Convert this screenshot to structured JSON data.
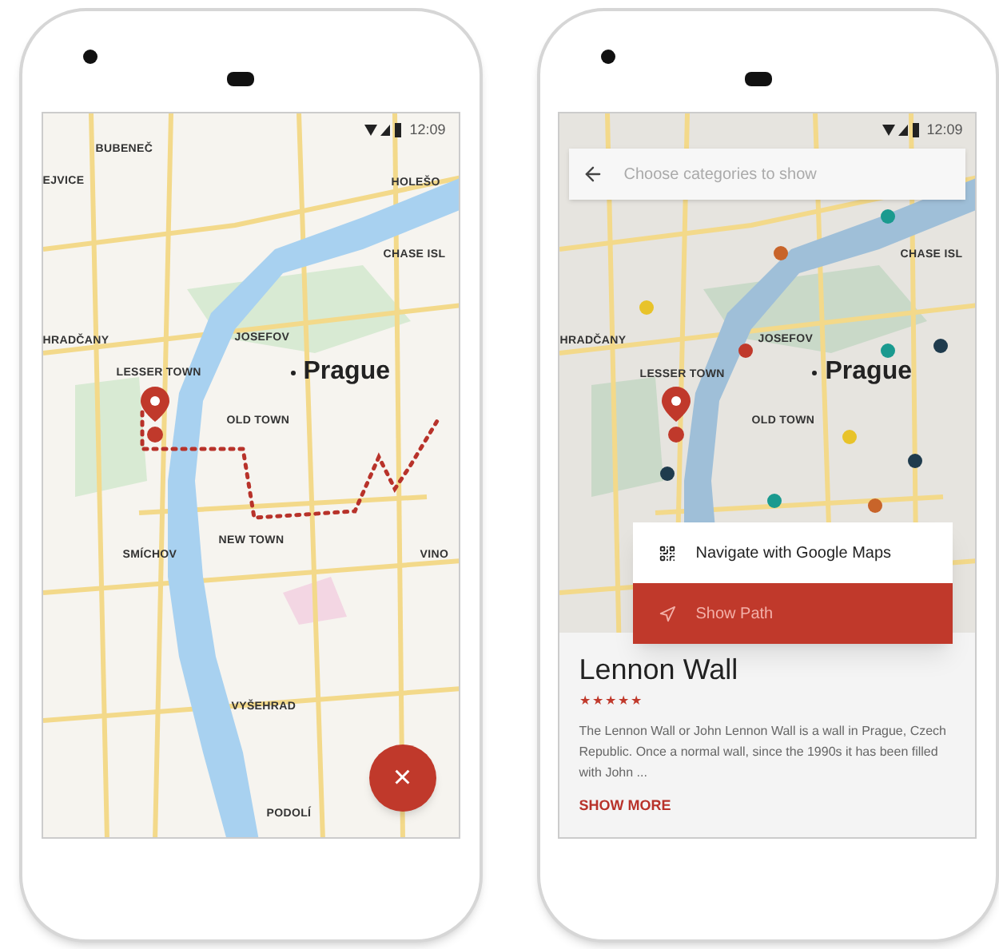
{
  "phones": [
    {
      "status": {
        "time": "12:09"
      },
      "map": {
        "labels": [
          {
            "text": "BUBENEČ",
            "kind": "district"
          },
          {
            "text": "EJVICE",
            "kind": "district"
          },
          {
            "text": "HOLEŠO",
            "kind": "district"
          },
          {
            "text": "CHASE ISL",
            "kind": "district"
          },
          {
            "text": "HRADČANY",
            "kind": "district"
          },
          {
            "text": "JOSEFOV",
            "kind": "district"
          },
          {
            "text": "LESSER TOWN",
            "kind": "district"
          },
          {
            "text": "Prague",
            "kind": "city"
          },
          {
            "text": "OLD TOWN",
            "kind": "district"
          },
          {
            "text": "NEW TOWN",
            "kind": "district"
          },
          {
            "text": "SMÍCHOV",
            "kind": "district"
          },
          {
            "text": "VINO",
            "kind": "district"
          },
          {
            "text": "VYŠEHRAD",
            "kind": "district"
          },
          {
            "text": "PODOLÍ",
            "kind": "district"
          }
        ],
        "route": true
      },
      "fab": {
        "label": "×"
      }
    },
    {
      "status": {
        "time": "12:09"
      },
      "search": {
        "placeholder": "Choose categories to show"
      },
      "map": {
        "labels": [
          {
            "text": "CHASE ISL",
            "kind": "district"
          },
          {
            "text": "HRADČANY",
            "kind": "district"
          },
          {
            "text": "JOSEFOV",
            "kind": "district"
          },
          {
            "text": "LESSER TOWN",
            "kind": "district"
          },
          {
            "text": "Prague",
            "kind": "city"
          },
          {
            "text": "OLD TOWN",
            "kind": "district"
          }
        ],
        "dots": [
          {
            "color": "#1a9a8f"
          },
          {
            "color": "#c8642a"
          },
          {
            "color": "#e8c32a"
          },
          {
            "color": "#c0392b"
          },
          {
            "color": "#1a9a8f"
          },
          {
            "color": "#1f3b4d"
          },
          {
            "color": "#e8c32a"
          },
          {
            "color": "#1f3b4d"
          },
          {
            "color": "#1f3b4d"
          },
          {
            "color": "#1a9a8f"
          },
          {
            "color": "#c8642a"
          }
        ]
      },
      "menu": [
        {
          "label": "Navigate with Google Maps",
          "kind": "navigate",
          "selected": false
        },
        {
          "label": "Show Path",
          "kind": "path",
          "selected": true
        }
      ],
      "card": {
        "title": "Lennon Wall",
        "stars": 5,
        "description": "The Lennon Wall or John Lennon Wall is a wall in Prague, Czech Republic. Once a normal wall, since the 1990s it has been filled with John ...",
        "link": "SHOW MORE"
      }
    }
  ]
}
